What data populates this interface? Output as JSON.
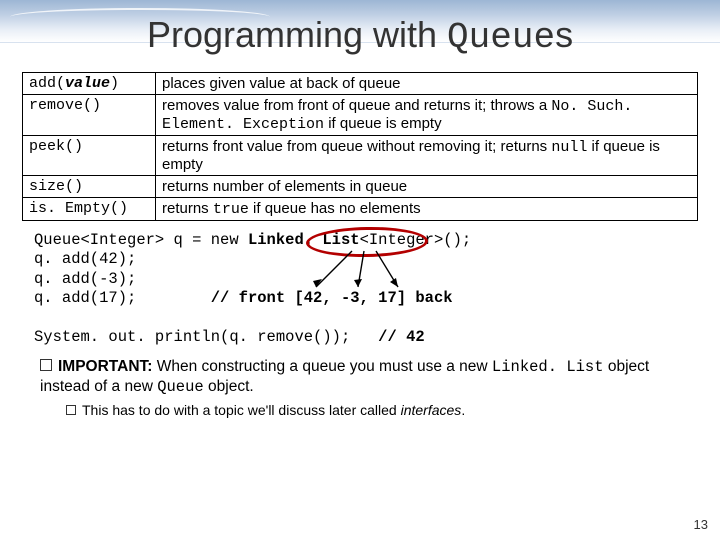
{
  "title_pre": "Programming with ",
  "title_code": "Queue",
  "title_post": "s",
  "rows": [
    {
      "method_pre": "add(",
      "method_param": "value",
      "method_post": ")",
      "desc": "places given value at back of queue"
    },
    {
      "method": "remove()",
      "desc_pre": "removes value from front of queue and returns it; throws a ",
      "desc_code": "No. Such. Element. Exception",
      "desc_post": " if queue is empty"
    },
    {
      "method": "peek()",
      "desc_pre": "returns front value from queue without removing it; returns ",
      "desc_code": "null",
      "desc_post": " if queue is empty"
    },
    {
      "method": "size()",
      "desc": "returns number of elements in queue"
    },
    {
      "method": "is. Empty()",
      "desc_pre": "returns ",
      "desc_code": "true",
      "desc_post": " if queue has no elements"
    }
  ],
  "code": {
    "l1a": "Queue<Integer> q = new ",
    "l1b": "Linked. List",
    "l1c": "<Integer>();",
    "l2": "q. add(42);",
    "l3": "q. add(-3);",
    "l4a": "q. add(17);        ",
    "l4b": "// front [42, -3, 17] back",
    "l5a": "System. out. println(q. remove());",
    "l5b": "   // 42"
  },
  "note_label": "IMPORTANT:",
  "note_body_1": " When constructing a queue you must use a new ",
  "note_code_1": "Linked. List",
  "note_body_2": " object instead of a new ",
  "note_code_2": "Queue",
  "note_body_3": " object.",
  "subnote_pre": "This has to do with a topic we'll discuss later called ",
  "subnote_em": "interfaces",
  "subnote_post": ".",
  "pagenum": "13"
}
